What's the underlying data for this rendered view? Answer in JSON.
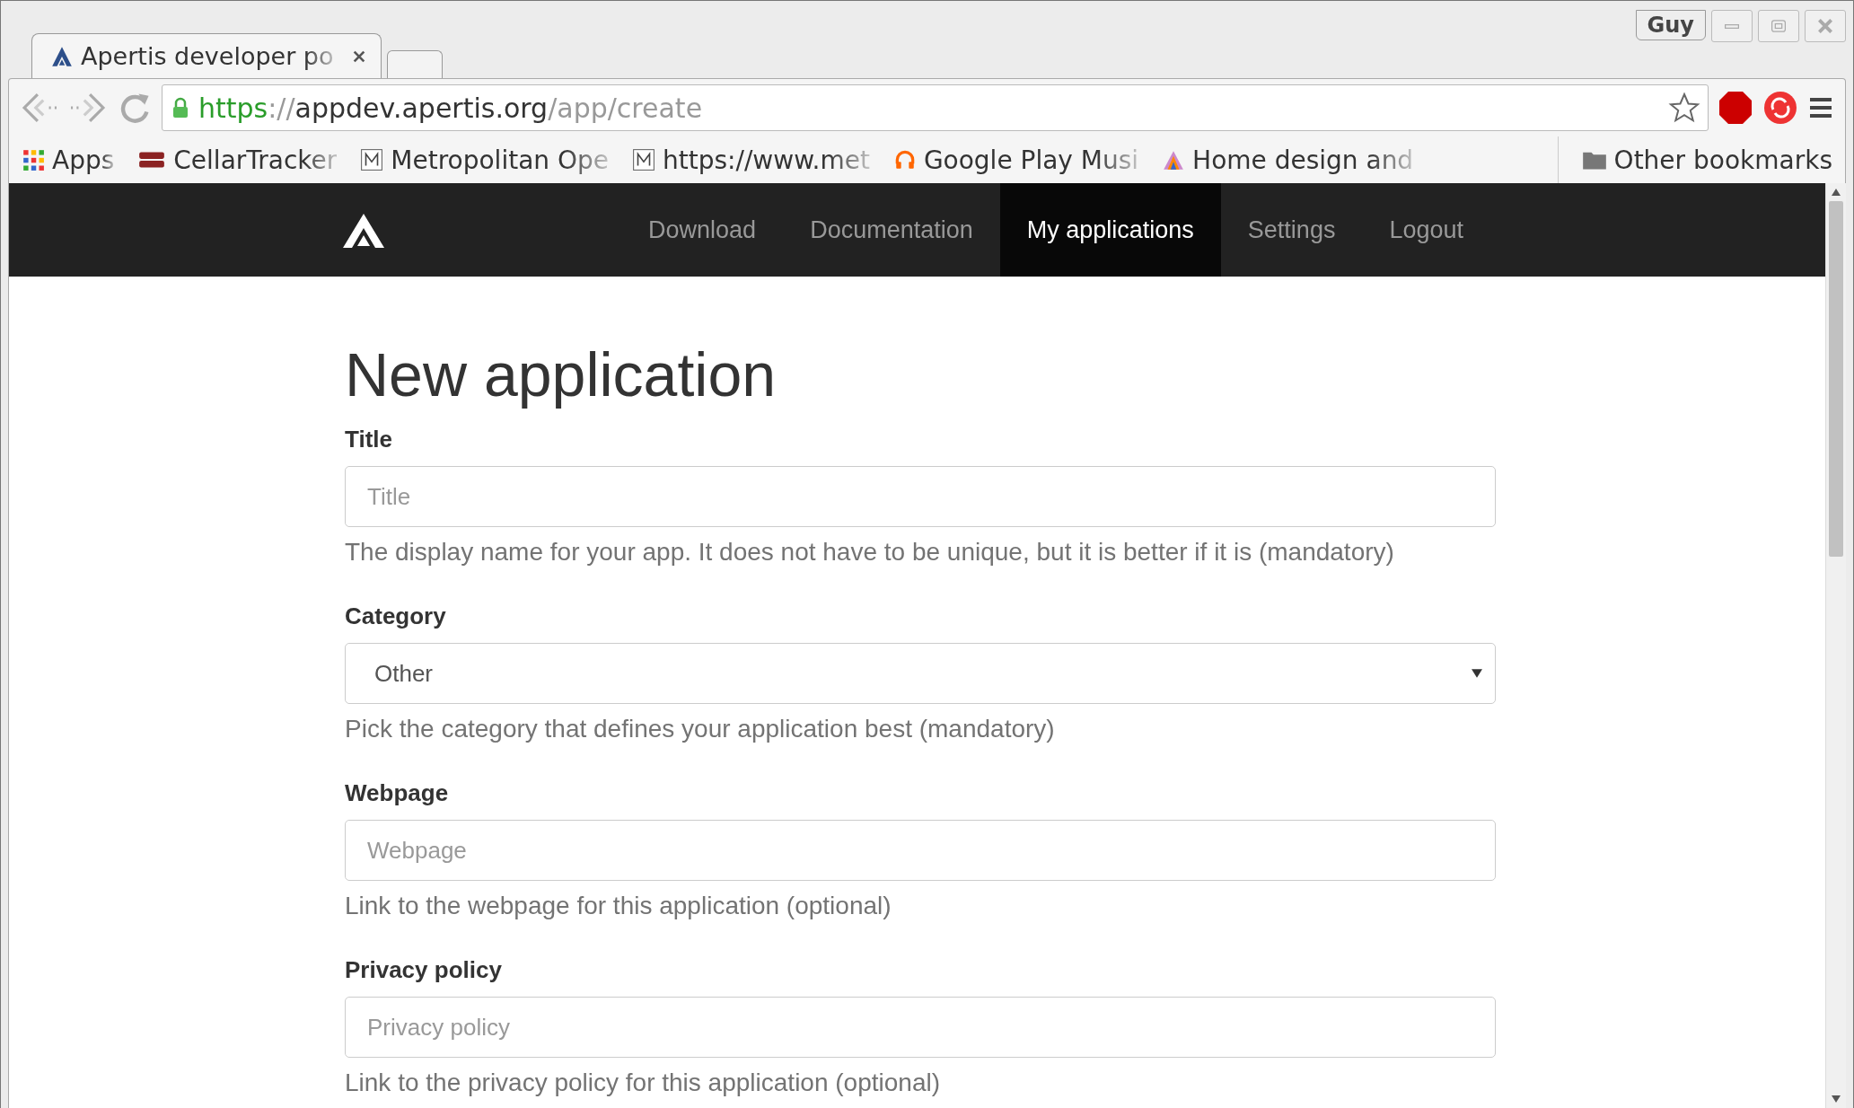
{
  "browser": {
    "tabs": [
      {
        "title": "Apertis developer po",
        "selected": true
      }
    ],
    "profile": "Guy",
    "url": {
      "scheme": "https",
      "separator": "://",
      "host": "appdev.apertis.org",
      "path": "/app/create"
    },
    "bookmarks": [
      {
        "label": "Apps"
      },
      {
        "label": "CellarTracker"
      },
      {
        "label": "Metropolitan Ope"
      },
      {
        "label": "https://www.met"
      },
      {
        "label": "Google Play Musi"
      },
      {
        "label": "Home design and"
      }
    ],
    "other_bookmarks": "Other bookmarks"
  },
  "nav": {
    "items": [
      {
        "label": "Download",
        "selected": false
      },
      {
        "label": "Documentation",
        "selected": false
      },
      {
        "label": "My applications",
        "selected": true
      },
      {
        "label": "Settings",
        "selected": false
      },
      {
        "label": "Logout",
        "selected": false
      }
    ]
  },
  "page": {
    "heading": "New application",
    "fields": [
      {
        "kind": "input",
        "label": "Title",
        "placeholder": "Title",
        "help": "The display name for your app. It does not have to be unique, but it is better if it is (mandatory)"
      },
      {
        "kind": "select",
        "label": "Category",
        "value": "Other",
        "help": "Pick the category that defines your application best (mandatory)"
      },
      {
        "kind": "input",
        "label": "Webpage",
        "placeholder": "Webpage",
        "help": "Link to the webpage for this application (optional)"
      },
      {
        "kind": "input",
        "label": "Privacy policy",
        "placeholder": "Privacy policy",
        "help": "Link to the privacy policy for this application (optional)"
      }
    ]
  }
}
